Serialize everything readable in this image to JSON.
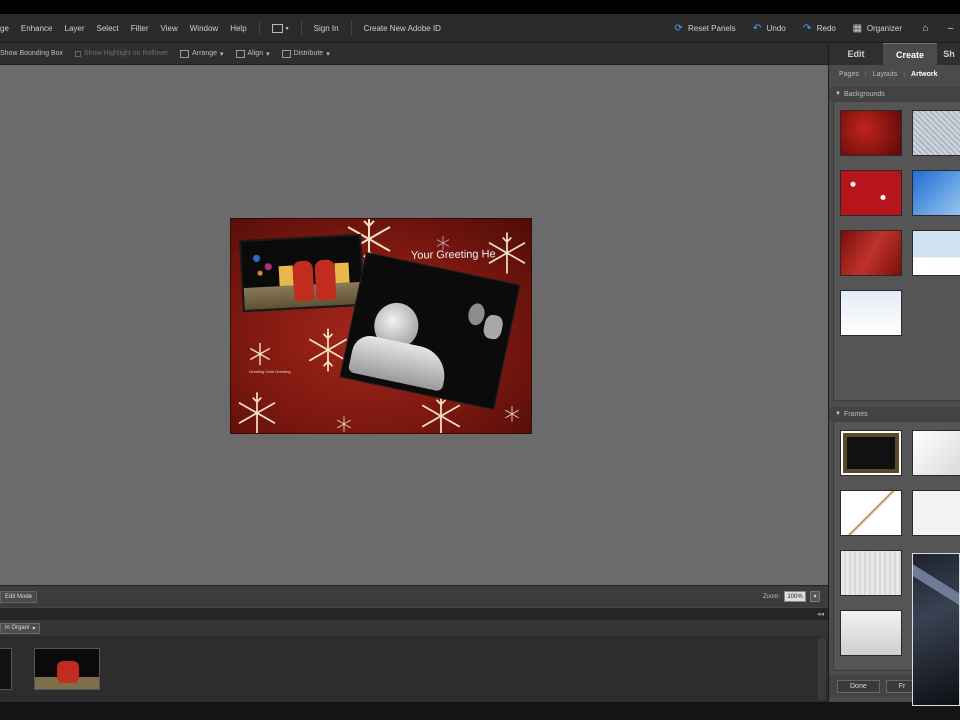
{
  "menubar": {
    "items": [
      "ge",
      "Enhance",
      "Layer",
      "Select",
      "Filter",
      "View",
      "Window",
      "Help"
    ],
    "sign_in": "Sign In",
    "create_id": "Create New Adobe ID",
    "reset_panels": "Reset Panels",
    "undo": "Undo",
    "redo": "Redo",
    "organizer": "Organizer"
  },
  "options_bar": {
    "show_bounding_box": "Show Bounding Box",
    "show_highlight": "Show Highlight on Rollover",
    "arrange": "Arrange",
    "align": "Align",
    "distribute": "Distribute"
  },
  "card": {
    "greeting": "Your Greeting He",
    "small_text": "Greeting Card Greeting"
  },
  "statusbar": {
    "mode_button": "Edit Mode",
    "zoom_label": "Zoom:",
    "zoom_value": "100%"
  },
  "bin": {
    "show_select": "in Organi"
  },
  "panel": {
    "tabs": [
      "Edit",
      "Create",
      "Sh"
    ],
    "subtabs": [
      "Pages",
      "Layouts",
      "Artwork"
    ],
    "backgrounds_label": "Backgrounds",
    "frames_label": "Frames",
    "done_button": "Done",
    "second_button": "Fr"
  },
  "colors": {
    "canvas": "#6b6b6b",
    "panel": "#4b4b4b",
    "card_red": "#a4261b",
    "snowflake": "#f2e2c6"
  }
}
